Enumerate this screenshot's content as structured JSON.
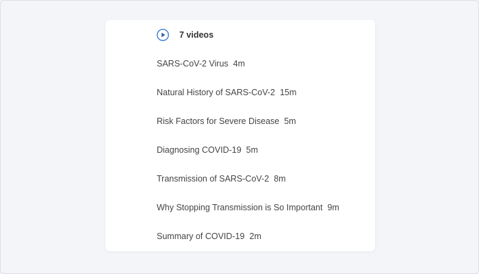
{
  "header": {
    "icon": "play-circle-icon",
    "label": "7 videos",
    "accent_color": "#3a7bd5"
  },
  "videos": [
    {
      "title": "SARS-CoV-2 Virus",
      "duration": "4m"
    },
    {
      "title": "Natural History of SARS-CoV-2",
      "duration": "15m"
    },
    {
      "title": "Risk Factors for Severe Disease",
      "duration": "5m"
    },
    {
      "title": "Diagnosing COVID-19",
      "duration": "5m"
    },
    {
      "title": "Transmission of SARS-CoV-2",
      "duration": "8m"
    },
    {
      "title": "Why Stopping Transmission is So Important",
      "duration": "9m"
    },
    {
      "title": "Summary of COVID-19",
      "duration": "2m"
    }
  ]
}
